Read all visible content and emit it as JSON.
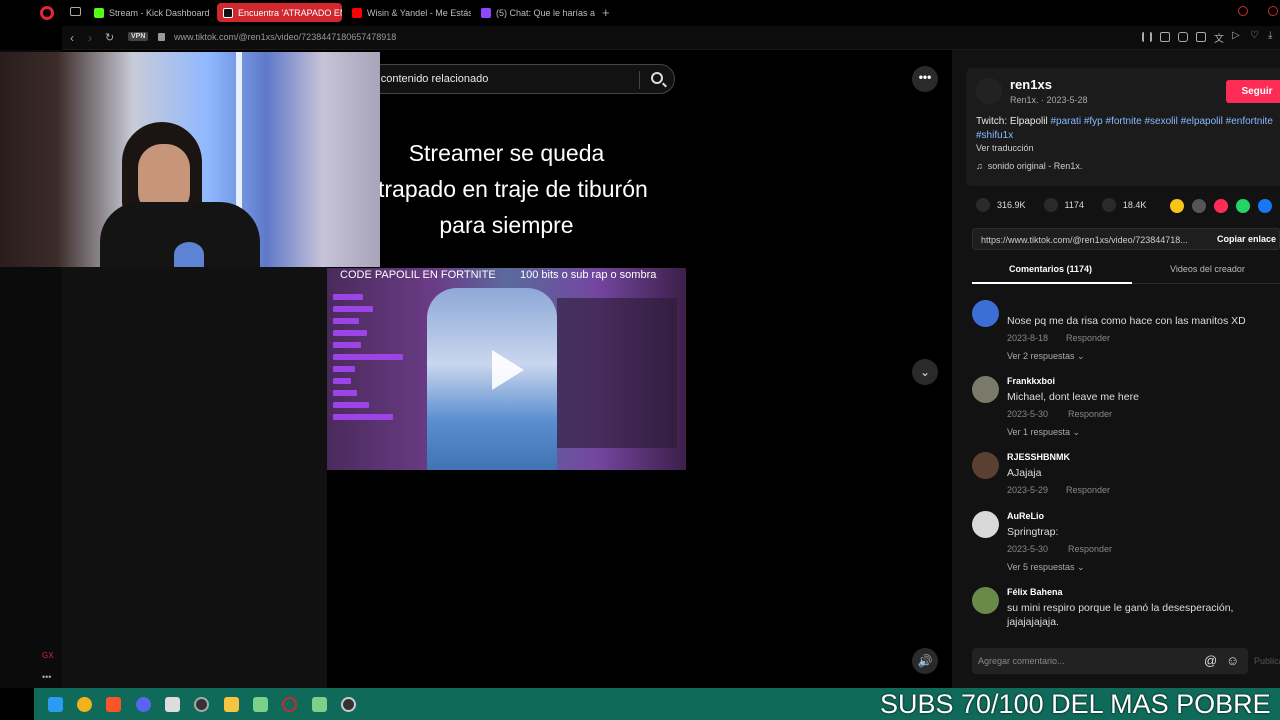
{
  "browser": {
    "tabs": [
      {
        "label": "Stream - Kick Dashboard",
        "color": "#53fc18"
      },
      {
        "label": "Encuentra 'ATRAPADO EN",
        "color": "#ff2c55",
        "active": true
      },
      {
        "label": "Wisin & Yandel - Me Estás",
        "color": "#ff0000"
      },
      {
        "label": "(5) Chat: Que le harías a T",
        "color": "#9147ff"
      }
    ],
    "vpn_label": "VPN",
    "url": "www.tiktok.com/@ren1xs/video/7238447180657478918"
  },
  "search": {
    "query": "r contenido relacionado"
  },
  "video": {
    "title_lines": [
      "Streamer se queda",
      "atrapado en traje de tiburón",
      "para siempre"
    ],
    "caption_left": "CODE PAPOLIL EN FORTNITE",
    "caption_right": "100 bits o sub rap o sombra"
  },
  "author": {
    "username": "ren1xs",
    "nickname": "Ren1x.",
    "date": "2023-5-28",
    "follow_label": "Seguir",
    "description_prefix": "Twitch: Elpapolil",
    "hashtags": [
      "#parati",
      "#fyp",
      "#fortnite",
      "#sexolil",
      "#elpapolil",
      "#enfortnite",
      "#shifu1x"
    ],
    "translate_label": "Ver traducción",
    "sound": "sonido original - Ren1x."
  },
  "stats": {
    "likes": "316.9K",
    "comments": "1174",
    "saves": "18.4K"
  },
  "share": {
    "link": "https://www.tiktok.com/@ren1xs/video/723844718...",
    "copy_label": "Copiar enlace",
    "colors": [
      "#f5c518",
      "#555555",
      "#fe2c55",
      "#25d366",
      "#1877f2"
    ]
  },
  "comment_tabs": {
    "comments": "Comentarios (1174)",
    "creator_videos": "Videos del creador"
  },
  "comments": [
    {
      "user": "",
      "text": "Nose pq me da risa como hace con las manitos XD",
      "date": "2023-8-18",
      "reply": "Responder",
      "more": "Ver 2 respuestas",
      "color": "#3b6fd6"
    },
    {
      "user": "Frankkxboi",
      "text": "Michael, dont leave me here",
      "date": "2023-5-30",
      "reply": "Responder",
      "more": "Ver 1 respuesta",
      "color": "#7a7a6a"
    },
    {
      "user": "RJESSHBNMK",
      "text": "AJajaja",
      "date": "2023-5-29",
      "reply": "Responder",
      "more": "",
      "color": "#5a4030"
    },
    {
      "user": "AuReLio",
      "text": "Springtrap:",
      "date": "2023-5-30",
      "reply": "Responder",
      "more": "Ver 5 respuestas",
      "color": "#d8d8d8"
    },
    {
      "user": "Félix Bahena",
      "text": "su mini respiro porque le ganó la desesperación, jajajajajaja.",
      "date": "",
      "reply": "",
      "more": "",
      "color": "#6a8a4a"
    }
  ],
  "add_comment": {
    "placeholder": "Agregar comentario...",
    "post": "Publicar"
  },
  "overlay": {
    "subs_text": "SUBS 70/100 DEL MAS POBRE"
  }
}
